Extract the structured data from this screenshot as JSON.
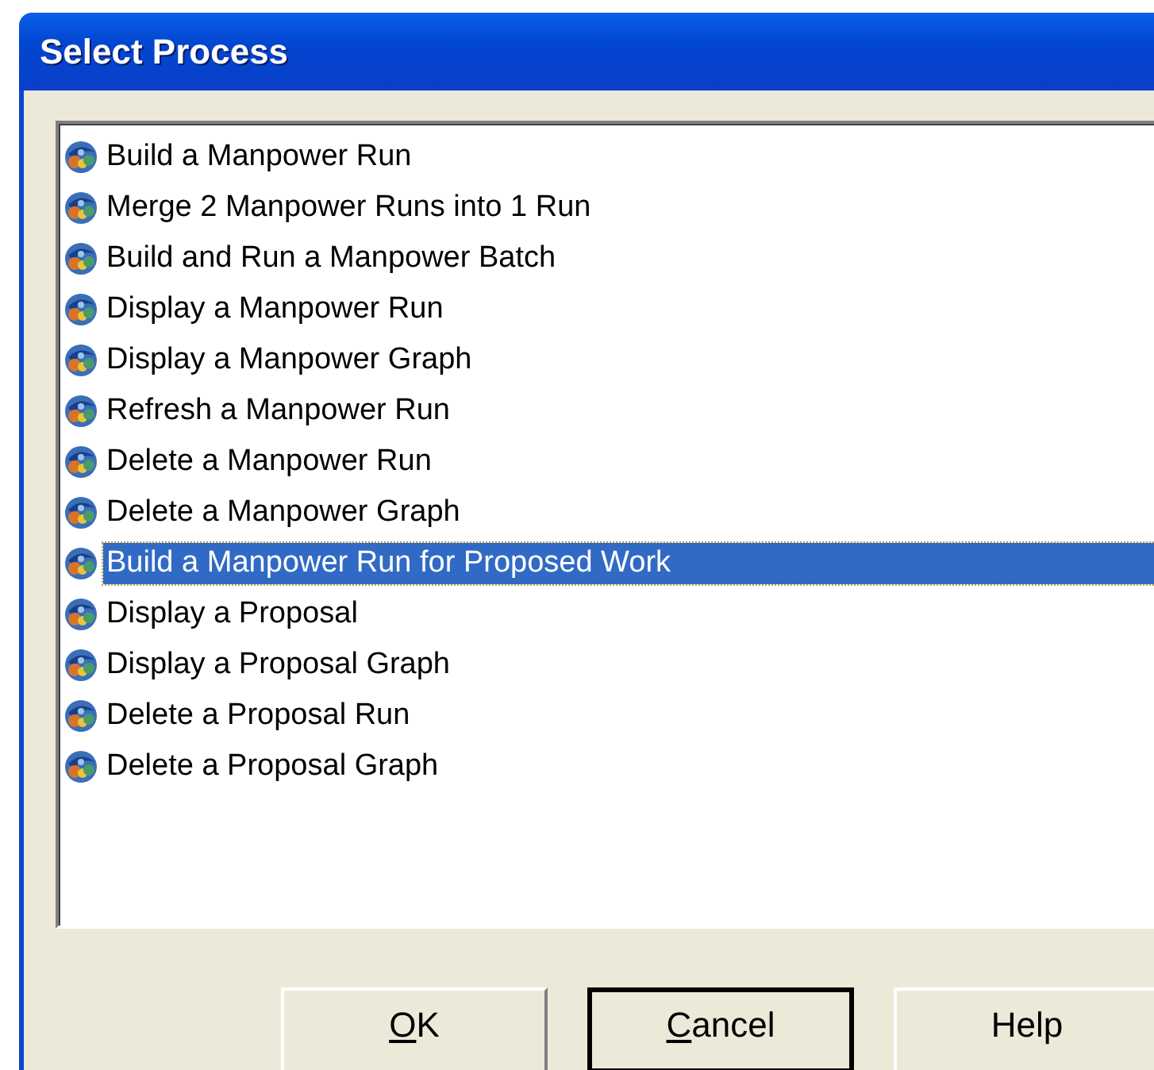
{
  "window": {
    "title": "Select Process"
  },
  "processes": [
    {
      "label": "Build a Manpower Run",
      "selected": false
    },
    {
      "label": "Merge 2 Manpower Runs into 1 Run",
      "selected": false
    },
    {
      "label": "Build and Run a Manpower Batch",
      "selected": false
    },
    {
      "label": "Display a Manpower Run",
      "selected": false
    },
    {
      "label": "Display a Manpower Graph",
      "selected": false
    },
    {
      "label": "Refresh a Manpower Run",
      "selected": false
    },
    {
      "label": "Delete a Manpower Run",
      "selected": false
    },
    {
      "label": "Delete a Manpower Graph",
      "selected": false
    },
    {
      "label": "Build a Manpower Run for Proposed Work",
      "selected": true
    },
    {
      "label": "Display a Proposal",
      "selected": false
    },
    {
      "label": "Display a Proposal Graph",
      "selected": false
    },
    {
      "label": "Delete a Proposal Run",
      "selected": false
    },
    {
      "label": "Delete a Proposal Graph",
      "selected": false
    }
  ],
  "buttons": [
    {
      "label": "OK",
      "mnemonic": true,
      "default": false
    },
    {
      "label": "Cancel",
      "mnemonic": true,
      "default": true
    },
    {
      "label": "Help",
      "mnemonic": false,
      "default": false
    }
  ]
}
